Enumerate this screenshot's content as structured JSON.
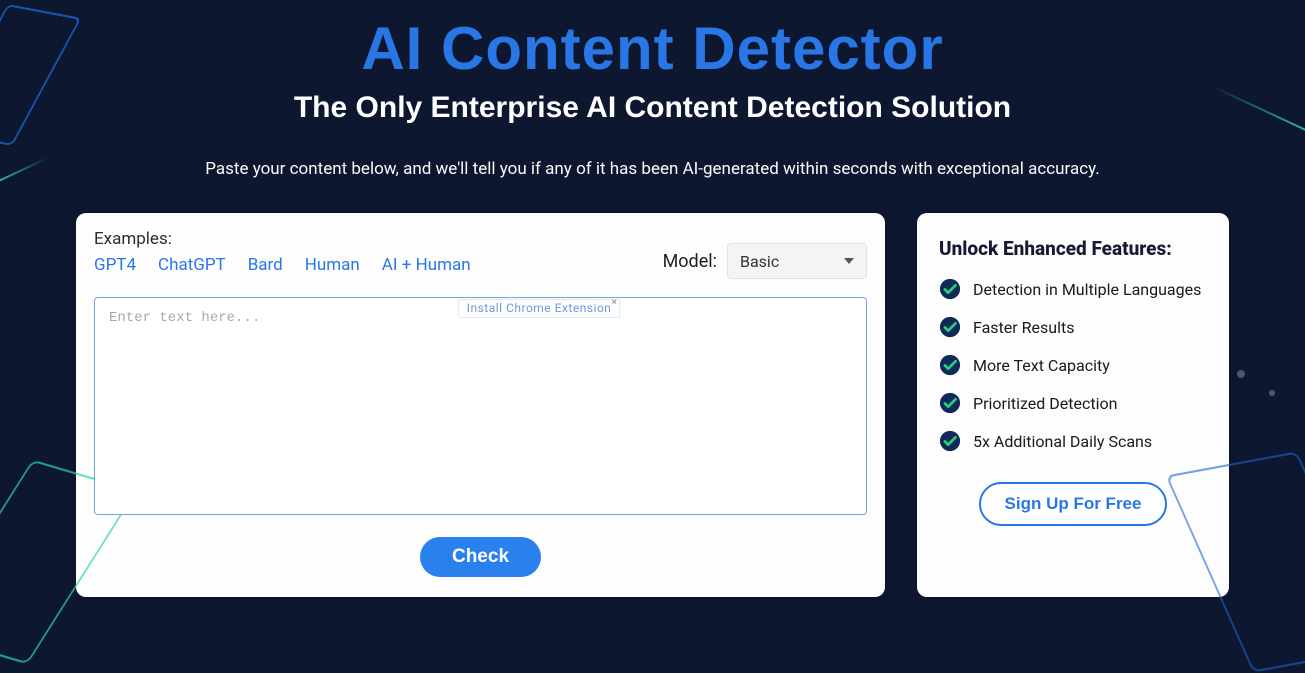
{
  "hero": {
    "title": "AI Content Detector",
    "subtitle": "The Only Enterprise AI Content Detection Solution",
    "description": "Paste your content below, and we'll tell you if any of it has been AI-generated within seconds with exceptional accuracy."
  },
  "examples": {
    "label": "Examples:",
    "links": [
      "GPT4",
      "ChatGPT",
      "Bard",
      "Human",
      "AI + Human"
    ]
  },
  "model": {
    "label": "Model:",
    "selected": "Basic"
  },
  "textarea": {
    "placeholder": "Enter text here...",
    "value": ""
  },
  "chrome_ext": {
    "label": "Install Chrome Extension"
  },
  "check_button": "Check",
  "sidebar": {
    "title": "Unlock Enhanced Features:",
    "features": [
      "Detection in Multiple Languages",
      "Faster Results",
      "More Text Capacity",
      "Prioritized Detection",
      "5x Additional Daily Scans"
    ],
    "cta": "Sign Up For Free"
  },
  "colors": {
    "accent": "#2977e6",
    "bg": "#0e1730",
    "teal": "#2dd4a7"
  }
}
